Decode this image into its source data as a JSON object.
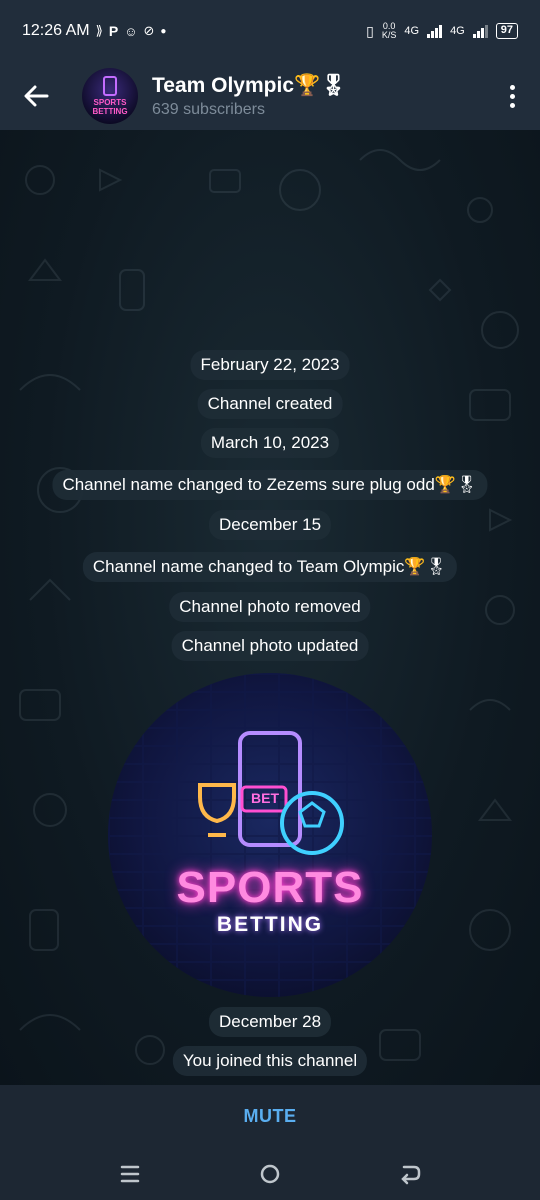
{
  "status_bar": {
    "time": "12:26 AM",
    "left_glyphs": [
      "P"
    ],
    "network_speed": "0.0\nK/S",
    "net1": "4G",
    "net2": "4G",
    "battery": "97"
  },
  "header": {
    "title": "Team Olympic🏆🎖",
    "subtitle": "639 subscribers",
    "avatar_text": "SPORTS\nBETTING"
  },
  "messages": [
    {
      "text": "February 22, 2023"
    },
    {
      "text": "Channel created"
    },
    {
      "text": "March 10, 2023"
    },
    {
      "text": "Channel name changed to Zezems sure plug odd🏆🎖"
    },
    {
      "text": "December 15"
    },
    {
      "text": "Channel name changed to Team Olympic🏆🎖"
    },
    {
      "text": "Channel photo removed"
    },
    {
      "text": "Channel photo updated"
    },
    {
      "text": "December 28"
    },
    {
      "text": "You joined this channel"
    }
  ],
  "photo": {
    "bet_text": "BET",
    "line1": "SPORTS",
    "line2": "BETTING"
  },
  "bottom": {
    "mute_label": "MUTE"
  },
  "icons": {
    "back": "arrow-left-icon",
    "menu": "more-vertical-icon",
    "nav_recents": "recents-icon",
    "nav_home": "home-icon",
    "nav_back": "back-icon"
  }
}
